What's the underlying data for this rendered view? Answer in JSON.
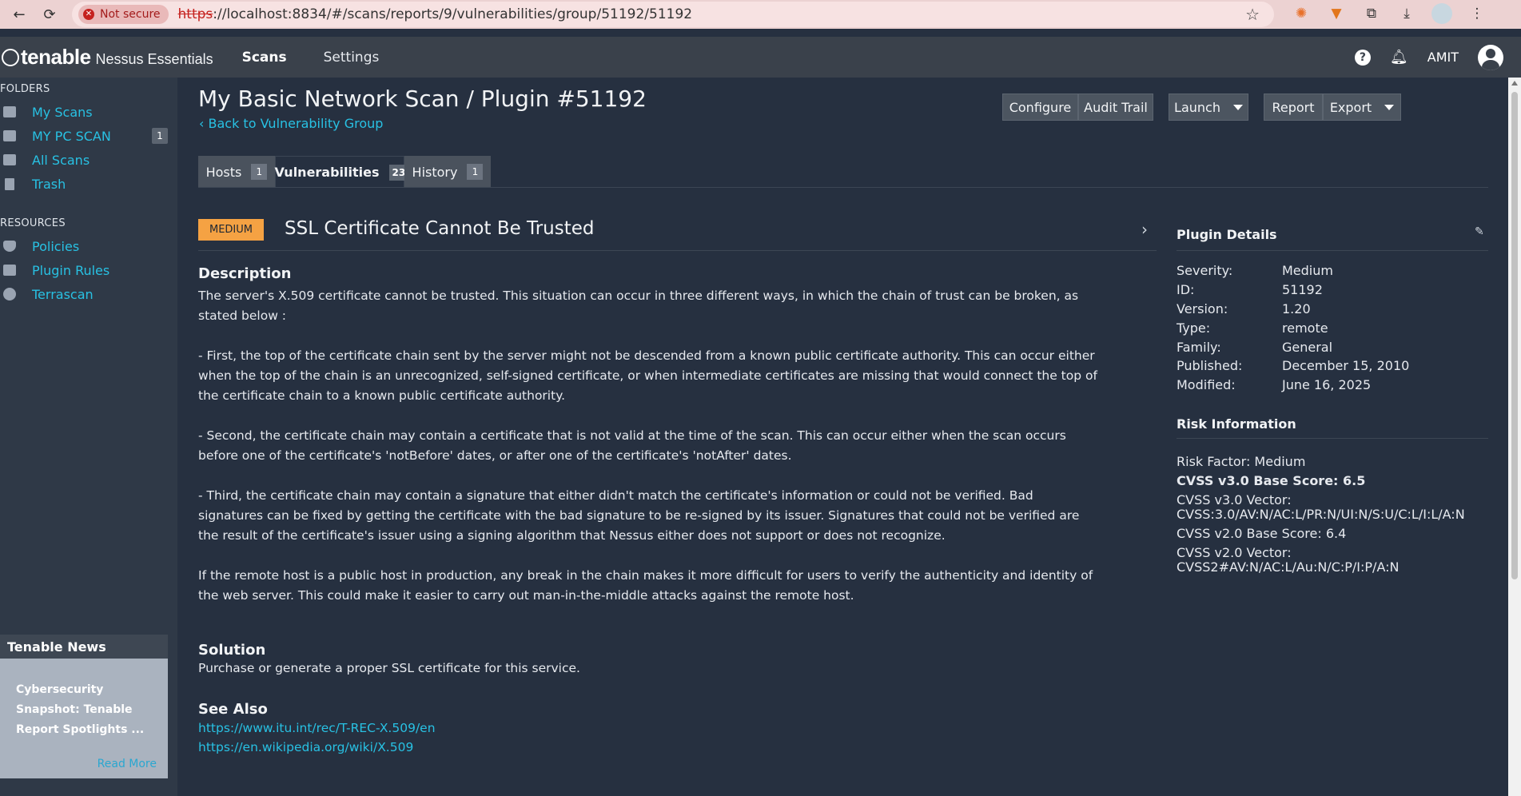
{
  "browser": {
    "security": "Not secure",
    "url_scheme": "https",
    "url_rest": "://localhost:8834/#/scans/reports/9/vulnerabilities/group/51192/51192"
  },
  "header": {
    "brand": "tenable",
    "product": "Nessus Essentials",
    "nav": [
      "Scans",
      "Settings"
    ],
    "user": "AMIT"
  },
  "sidebar": {
    "folders_label": "FOLDERS",
    "folders": [
      {
        "label": "My Scans",
        "icon": "folder-icon"
      },
      {
        "label": "MY PC SCAN",
        "icon": "folder-icon",
        "count": "1"
      },
      {
        "label": "All Scans",
        "icon": "folder-icon"
      },
      {
        "label": "Trash",
        "icon": "trash-icon"
      }
    ],
    "resources_label": "RESOURCES",
    "resources": [
      {
        "label": "Policies",
        "icon": "shield-icon"
      },
      {
        "label": "Plugin Rules",
        "icon": "plugin-rules-icon"
      },
      {
        "label": "Terrascan",
        "icon": "terrascan-icon"
      }
    ],
    "news": {
      "title": "Tenable News",
      "headline_l1": "Cybersecurity",
      "headline_l2": "Snapshot: Tenable",
      "headline_l3": "Report Spotlights ...",
      "read_more": "Read More"
    }
  },
  "page": {
    "title": "My Basic Network Scan / Plugin #51192",
    "back": "Back to Vulnerability Group",
    "buttons": {
      "configure": "Configure",
      "audit": "Audit Trail",
      "launch": "Launch",
      "report": "Report",
      "export": "Export"
    },
    "tabs": [
      {
        "label": "Hosts",
        "count": "1"
      },
      {
        "label": "Vulnerabilities",
        "count": "23"
      },
      {
        "label": "History",
        "count": "1"
      }
    ]
  },
  "vuln": {
    "severity": "MEDIUM",
    "title": "SSL Certificate Cannot Be Trusted",
    "description_heading": "Description",
    "description": [
      "The server's X.509 certificate cannot be trusted. This situation can occur in three different ways, in which the chain of trust can be broken, as stated below :",
      "- First, the top of the certificate chain sent by the server might not be descended from a known public certificate authority. This can occur either when the top of the chain is an unrecognized, self-signed certificate, or when intermediate certificates are missing that would connect the top of the certificate chain to a known public certificate authority.",
      "- Second, the certificate chain may contain a certificate that is not valid at the time of the scan. This can occur either when the scan occurs before one of the certificate's 'notBefore' dates, or after one of the certificate's 'notAfter' dates.",
      "- Third, the certificate chain may contain a signature that either didn't match the certificate's information or could not be verified. Bad signatures can be fixed by getting the certificate with the bad signature to be re-signed by its issuer. Signatures that could not be verified are the result of the certificate's issuer using a signing algorithm that Nessus either does not support or does not recognize.",
      "If the remote host is a public host in production, any break in the chain makes it more difficult for users to verify the authenticity and identity of the web server. This could make it easier to carry out man-in-the-middle attacks against the remote host."
    ],
    "solution_heading": "Solution",
    "solution": "Purchase or generate a proper SSL certificate for this service.",
    "see_also_heading": "See Also",
    "see_also": [
      "https://www.itu.int/rec/T-REC-X.509/en",
      "https://en.wikipedia.org/wiki/X.509"
    ]
  },
  "plugin_details": {
    "heading": "Plugin Details",
    "rows": [
      {
        "k": "Severity:",
        "v": "Medium"
      },
      {
        "k": "ID:",
        "v": "51192"
      },
      {
        "k": "Version:",
        "v": "1.20"
      },
      {
        "k": "Type:",
        "v": "remote"
      },
      {
        "k": "Family:",
        "v": "General"
      },
      {
        "k": "Published:",
        "v": "December 15, 2010"
      },
      {
        "k": "Modified:",
        "v": "June 16, 2025"
      }
    ]
  },
  "risk_info": {
    "heading": "Risk Information",
    "risk_factor": "Risk Factor: Medium",
    "cvss3_base": "CVSS v3.0 Base Score: 6.5",
    "cvss3_vector_label": "CVSS v3.0 Vector:",
    "cvss3_vector": "CVSS:3.0/AV:N/AC:L/PR:N/UI:N/S:U/C:L/I:L/A:N",
    "cvss2_base": "CVSS v2.0 Base Score: 6.4",
    "cvss2_vector_label": "CVSS v2.0 Vector:",
    "cvss2_vector": "CVSS2#AV:N/AC:L/Au:N/C:P/I:P/A:N"
  },
  "colors": {
    "accent": "#28c1e3",
    "severity_medium": "#f5a243",
    "background": "#263040"
  }
}
